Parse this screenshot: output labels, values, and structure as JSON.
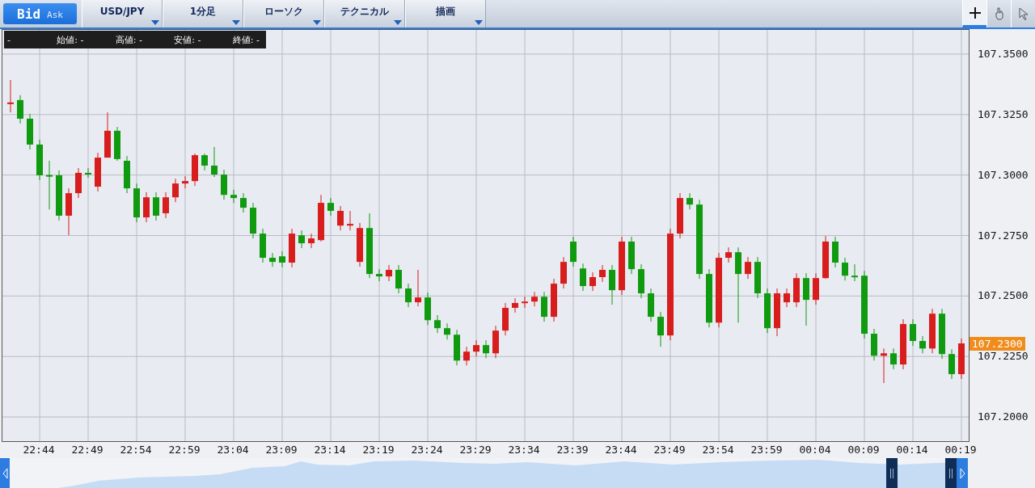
{
  "toolbar": {
    "price_toggle": [
      {
        "label": "Bid",
        "selected": true
      },
      {
        "label": "Ask",
        "selected": false
      }
    ],
    "dropdowns": [
      {
        "label": "USD/JPY"
      },
      {
        "label": "1分足"
      },
      {
        "label": "ローソク"
      },
      {
        "label": "テクニカル"
      },
      {
        "label": "描画"
      }
    ],
    "tools": [
      {
        "kind": "crosshair",
        "selected": true
      },
      {
        "kind": "hand",
        "selected": false
      },
      {
        "kind": "pointer",
        "selected": false
      }
    ]
  },
  "ohlc_bar": {
    "lead": "-",
    "items": [
      {
        "label": "始値:",
        "value": "-"
      },
      {
        "label": "高値:",
        "value": "-"
      },
      {
        "label": "安値:",
        "value": "-"
      },
      {
        "label": "終値:",
        "value": "-"
      }
    ]
  },
  "current_price": "107.2300",
  "time_axis": [
    "22:44",
    "22:49",
    "22:54",
    "22:59",
    "23:04",
    "23:09",
    "23:14",
    "23:19",
    "23:24",
    "23:29",
    "23:34",
    "23:39",
    "23:44",
    "23:49",
    "23:54",
    "23:59",
    "00:04",
    "00:09",
    "00:14",
    "00:19"
  ],
  "chart": {
    "chart_data": {
      "type": "candlestick",
      "ylim": [
        107.19,
        107.36
      ],
      "yticks": [
        {
          "value": 107.35,
          "label": "107.3500"
        },
        {
          "value": 107.325,
          "label": "107.3250"
        },
        {
          "value": 107.3,
          "label": "107.3000"
        },
        {
          "value": 107.275,
          "label": "107.2750"
        },
        {
          "value": 107.25,
          "label": "107.2500"
        },
        {
          "value": 107.225,
          "label": "107.2250"
        },
        {
          "value": 107.2,
          "label": "107.2000"
        }
      ],
      "grid": true,
      "ohlc": [
        [
          107.3298,
          107.3393,
          107.3259,
          107.33
        ],
        [
          107.331,
          107.333,
          107.3213,
          107.3233
        ],
        [
          107.3233,
          107.3253,
          107.3106,
          107.3126
        ],
        [
          107.3126,
          107.3146,
          107.2979,
          107.2999
        ],
        [
          107.3,
          107.3059,
          107.2858,
          107.2999
        ],
        [
          107.2999,
          107.3019,
          107.2812,
          107.2832
        ],
        [
          107.2832,
          107.2945,
          107.2751,
          107.2925
        ],
        [
          107.2925,
          107.3029,
          107.2905,
          107.3009
        ],
        [
          107.3009,
          107.3029,
          107.2989,
          107.3008
        ],
        [
          107.2952,
          107.3092,
          107.2932,
          107.3072
        ],
        [
          107.3072,
          107.3259,
          107.3072,
          107.3183
        ],
        [
          107.3183,
          107.3199,
          107.3059,
          107.3066
        ],
        [
          107.3059,
          107.3079,
          107.2925,
          107.2945
        ],
        [
          107.2945,
          107.2965,
          107.2805,
          107.2825
        ],
        [
          107.2825,
          107.2929,
          107.2805,
          107.2908
        ],
        [
          107.2908,
          107.2929,
          107.2812,
          107.2832
        ],
        [
          107.2842,
          107.2929,
          107.2822,
          107.2908
        ],
        [
          107.2908,
          107.2985,
          107.2888,
          107.2965
        ],
        [
          107.2965,
          107.2995,
          107.2945,
          107.2975
        ],
        [
          107.2975,
          107.3089,
          107.2955,
          107.3082
        ],
        [
          107.3082,
          107.3089,
          107.3019,
          107.3039
        ],
        [
          107.3039,
          107.3116,
          107.2992,
          107.3002
        ],
        [
          107.3002,
          107.3022,
          107.2898,
          107.2918
        ],
        [
          107.2918,
          107.2939,
          107.2885,
          107.2905
        ],
        [
          107.2905,
          107.2925,
          107.2845,
          107.2865
        ],
        [
          107.2865,
          107.2885,
          107.2738,
          107.2758
        ],
        [
          107.2758,
          107.2778,
          107.2638,
          107.2658
        ],
        [
          107.2658,
          107.2678,
          107.2621,
          107.2641
        ],
        [
          107.2664,
          107.2685,
          107.2618,
          107.2638
        ],
        [
          107.2638,
          107.2778,
          107.2618,
          107.2758
        ],
        [
          107.2751,
          107.2771,
          107.2698,
          107.2718
        ],
        [
          107.2718,
          107.2758,
          107.2698,
          107.2738
        ],
        [
          107.2731,
          107.2918,
          107.2725,
          107.2885
        ],
        [
          107.2885,
          107.2905,
          107.2832,
          107.2852
        ],
        [
          107.2791,
          107.2872,
          107.2771,
          107.2852
        ],
        [
          107.2791,
          107.2852,
          107.2771,
          107.2798
        ],
        [
          107.2641,
          107.2802,
          107.2621,
          107.2781
        ],
        [
          107.2781,
          107.2842,
          107.2574,
          107.2591
        ],
        [
          107.2591,
          107.2611,
          107.2561,
          107.2581
        ],
        [
          107.2581,
          107.2628,
          107.2561,
          107.2608
        ],
        [
          107.2608,
          107.2628,
          107.2511,
          107.2531
        ],
        [
          107.2531,
          107.2551,
          107.2454,
          107.2474
        ],
        [
          107.2474,
          107.2608,
          107.2457,
          107.2494
        ],
        [
          107.2494,
          107.2514,
          107.238,
          107.24
        ],
        [
          107.24,
          107.2421,
          107.2347,
          107.2367
        ],
        [
          107.2367,
          107.2387,
          107.232,
          107.234
        ],
        [
          107.234,
          107.236,
          107.2213,
          107.2233
        ],
        [
          107.2233,
          107.229,
          107.2213,
          107.227
        ],
        [
          107.227,
          107.2317,
          107.225,
          107.2297
        ],
        [
          107.2297,
          107.2317,
          107.2243,
          107.2263
        ],
        [
          107.2263,
          107.2377,
          107.2243,
          107.2357
        ],
        [
          107.2357,
          107.2471,
          107.2337,
          107.2451
        ],
        [
          107.2451,
          107.2491,
          107.2431,
          107.2471
        ],
        [
          107.2471,
          107.2497,
          107.2451,
          107.2477
        ],
        [
          107.2477,
          107.2517,
          107.2457,
          107.2497
        ],
        [
          107.2497,
          107.2517,
          107.2394,
          107.2414
        ],
        [
          107.2414,
          107.2571,
          107.2394,
          107.2551
        ],
        [
          107.2551,
          107.2661,
          107.2531,
          107.2641
        ],
        [
          107.2725,
          107.2745,
          107.2621,
          107.2641
        ],
        [
          107.2614,
          107.2634,
          107.2521,
          107.2541
        ],
        [
          107.2541,
          107.2598,
          107.2521,
          107.2578
        ],
        [
          107.2578,
          107.2628,
          107.2558,
          107.2608
        ],
        [
          107.2608,
          107.2628,
          107.2464,
          107.2524
        ],
        [
          107.2524,
          107.2745,
          107.2504,
          107.2725
        ],
        [
          107.2725,
          107.2745,
          107.2591,
          107.2611
        ],
        [
          107.2611,
          107.2631,
          107.2491,
          107.2511
        ],
        [
          107.2511,
          107.2531,
          107.2394,
          107.2414
        ],
        [
          107.2414,
          107.2434,
          107.229,
          107.2337
        ],
        [
          107.2337,
          107.2778,
          107.2317,
          107.2758
        ],
        [
          107.2758,
          107.2925,
          107.2738,
          107.2905
        ],
        [
          107.2905,
          107.2925,
          107.2858,
          107.2878
        ],
        [
          107.2878,
          107.2898,
          107.2571,
          107.2591
        ],
        [
          107.2591,
          107.2611,
          107.237,
          107.239
        ],
        [
          107.239,
          107.2678,
          107.237,
          107.2658
        ],
        [
          107.2658,
          107.2701,
          107.2638,
          107.2681
        ],
        [
          107.2681,
          107.2701,
          107.239,
          107.2591
        ],
        [
          107.2591,
          107.2661,
          107.2571,
          107.2641
        ],
        [
          107.2641,
          107.2661,
          107.2491,
          107.2511
        ],
        [
          107.2511,
          107.2531,
          107.2347,
          107.2367
        ],
        [
          107.2367,
          107.2531,
          107.2334,
          107.2511
        ],
        [
          107.2474,
          107.2531,
          107.2454,
          107.2511
        ],
        [
          107.2474,
          107.2594,
          107.2454,
          107.2574
        ],
        [
          107.2574,
          107.2594,
          107.2377,
          107.2484
        ],
        [
          107.2484,
          107.2594,
          107.2464,
          107.2574
        ],
        [
          107.2574,
          107.2748,
          107.2571,
          107.2725
        ],
        [
          107.2725,
          107.2745,
          107.2618,
          107.2638
        ],
        [
          107.2638,
          107.2658,
          107.2564,
          107.2584
        ],
        [
          107.2584,
          107.2631,
          107.2561,
          107.2581
        ],
        [
          107.2584,
          107.2604,
          107.2324,
          107.2344
        ],
        [
          107.2344,
          107.2364,
          107.2233,
          107.2253
        ],
        [
          107.2253,
          107.2283,
          107.214,
          107.2263
        ],
        [
          107.2263,
          107.2283,
          107.2197,
          107.2217
        ],
        [
          107.2217,
          107.2404,
          107.2197,
          107.2384
        ],
        [
          107.2384,
          107.2404,
          107.2294,
          107.2314
        ],
        [
          107.2314,
          107.2334,
          107.2263,
          107.2283
        ],
        [
          107.2283,
          107.2447,
          107.2263,
          107.2427
        ],
        [
          107.2427,
          107.2447,
          107.224,
          107.226
        ],
        [
          107.226,
          107.228,
          107.2157,
          107.2177
        ],
        [
          107.2177,
          107.2324,
          107.2157,
          107.2304
        ]
      ]
    }
  }
}
